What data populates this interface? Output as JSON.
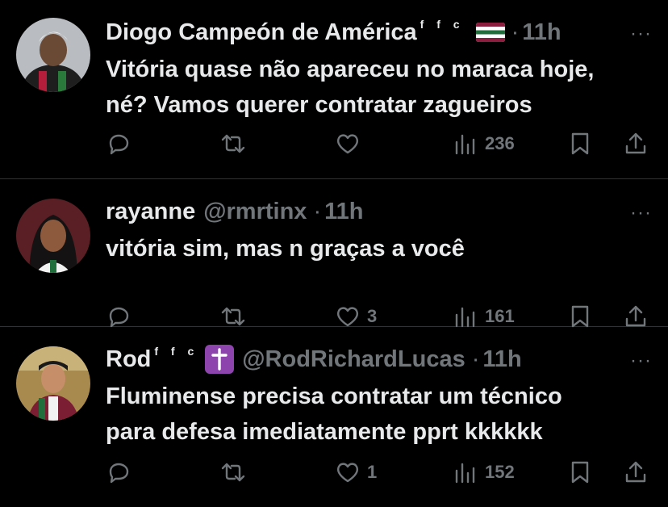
{
  "tweets": [
    {
      "name": "Diogo Campeón de América",
      "badge": "f f c",
      "handle": "",
      "time": "11h",
      "lines": [
        "Vitória quase não apareceu no maraca hoje,",
        "né? Vamos querer contratar zagueiros"
      ],
      "likes": "",
      "views": "236"
    },
    {
      "name": "rayanne",
      "badge": "",
      "handle": "@rmrtinx",
      "time": "11h",
      "lines": [
        "vitória sim, mas n graças a você"
      ],
      "likes": "3",
      "views": "161"
    },
    {
      "name": "Rod",
      "badge": "f f c",
      "handle": "@RodRichardLucas",
      "time": "11h",
      "lines": [
        "Fluminense precisa contratar um técnico",
        "para defesa imediatamente pprt kkkkkk"
      ],
      "likes": "1",
      "views": "152"
    }
  ],
  "separator": "·",
  "more": "···",
  "icons": [
    "reply-icon",
    "retweet-icon",
    "like-icon",
    "views-icon",
    "bookmark-icon",
    "share-icon"
  ],
  "colors": {
    "background": "#000000",
    "text": "#e7e9ea",
    "muted": "#71767b",
    "divider": "#2f3336"
  }
}
